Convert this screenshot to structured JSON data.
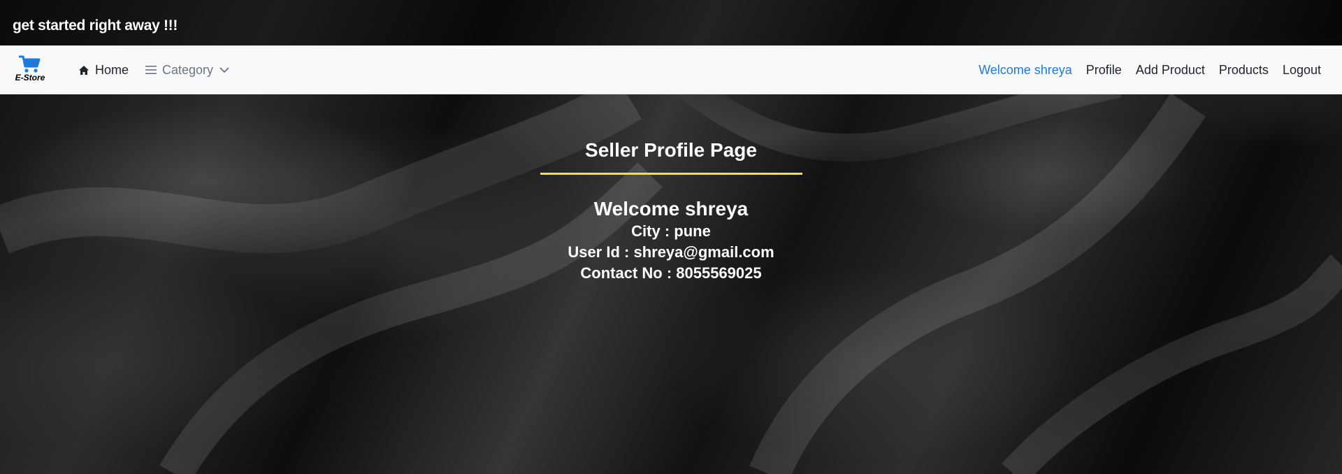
{
  "marquee": {
    "text": "get started right away !!!"
  },
  "navbar": {
    "brand": {
      "icon": "shopping-cart-icon",
      "text": "E-Store",
      "color": "#1e7ad9"
    },
    "home_label": "Home",
    "category_label": "Category",
    "right_items": {
      "welcome": "Welcome shreya",
      "profile": "Profile",
      "add_product": "Add Product",
      "products": "Products",
      "logout": "Logout"
    }
  },
  "profile": {
    "title": "Seller Profile Page",
    "welcome": "Welcome shreya",
    "city": "City : pune",
    "user_id": "User Id : shreya@gmail.com",
    "contact": "Contact No : 8055569025"
  },
  "colors": {
    "accent_link": "#1e7ad9",
    "rule": "#f6e32b",
    "navbar_bg": "#f8f9fa"
  }
}
